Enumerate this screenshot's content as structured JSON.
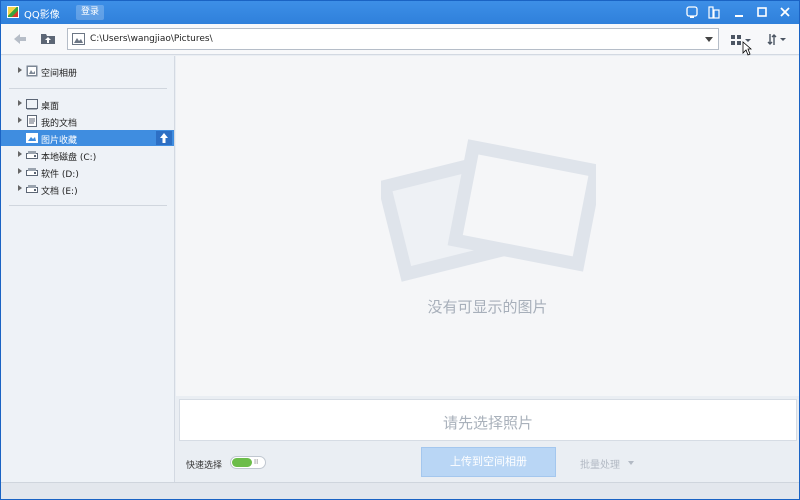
{
  "window": {
    "title": "QQ影像",
    "login_label": "登录"
  },
  "toolbar": {
    "address_path": "C:\\Users\\wangjiao\\Pictures\\"
  },
  "sidebar": {
    "groups": [
      {
        "items": [
          {
            "label": "空间相册",
            "icon": "cloud-album-icon"
          }
        ]
      },
      {
        "items": [
          {
            "label": "桌面",
            "icon": "desktop-icon"
          },
          {
            "label": "我的文档",
            "icon": "documents-icon"
          },
          {
            "label": "图片收藏",
            "icon": "pictures-icon",
            "selected": true
          },
          {
            "label": "本地磁盘 (C:)",
            "icon": "drive-icon"
          },
          {
            "label": "软件 (D:)",
            "icon": "drive-icon"
          },
          {
            "label": "文档 (E:)",
            "icon": "drive-icon"
          }
        ]
      }
    ]
  },
  "main": {
    "empty_text": "没有可显示的图片",
    "hint_text": "请先选择照片"
  },
  "footer": {
    "quick_select_label": "快速选择",
    "upload_label": "上传到空间相册",
    "batch_label": "批量处理"
  },
  "colors": {
    "title_bar": "#2f80db",
    "selection": "#3f8de0",
    "toggle_on": "#6cbd4a"
  }
}
